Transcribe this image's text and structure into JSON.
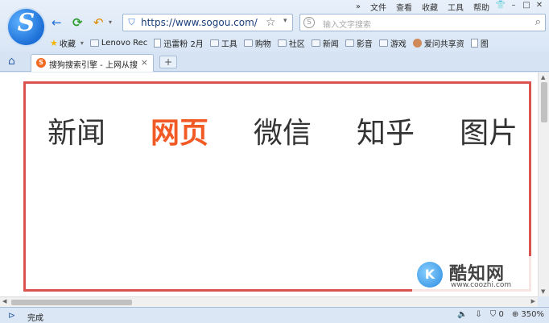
{
  "menu": {
    "items": [
      "文件",
      "查看",
      "收藏",
      "工具",
      "帮助"
    ],
    "chevron": "»"
  },
  "toolbar": {
    "back_icon": "←",
    "refresh_icon": "⟳",
    "undo_icon": "↶",
    "url": "https://www.sogou.com/",
    "search_placeholder": "输入文字搜索"
  },
  "bookmarks": [
    {
      "label": "收藏",
      "kind": "star"
    },
    {
      "label": "Lenovo Rec",
      "kind": "folder"
    },
    {
      "label": "迅雷粉 2月",
      "kind": "doc"
    },
    {
      "label": "工具",
      "kind": "folder"
    },
    {
      "label": "购物",
      "kind": "folder"
    },
    {
      "label": "社区",
      "kind": "folder"
    },
    {
      "label": "新闻",
      "kind": "folder"
    },
    {
      "label": "影音",
      "kind": "folder"
    },
    {
      "label": "游戏",
      "kind": "folder"
    },
    {
      "label": "爱问共享资",
      "kind": "avatar"
    },
    {
      "label": "图",
      "kind": "doc"
    }
  ],
  "tabs": [
    {
      "title": "搜狗搜索引擎 - 上网从搜"
    }
  ],
  "page": {
    "nav": [
      "新闻",
      "网页",
      "微信",
      "知乎",
      "图片"
    ],
    "active": "网页"
  },
  "watermark": {
    "title": "酷知网",
    "url": "www.coozhi.com"
  },
  "status": {
    "text": "完成",
    "shield_count": "0",
    "zoom": "350%"
  },
  "colors": {
    "accent": "#f15a24",
    "highlight_box": "#d9534f",
    "logo": "#1c6fd6"
  }
}
